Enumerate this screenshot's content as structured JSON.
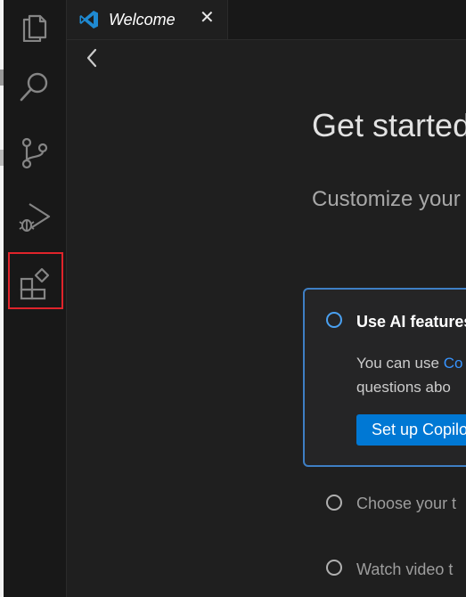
{
  "activity_bar": {
    "items": [
      {
        "name": "explorer",
        "icon": "files-icon"
      },
      {
        "name": "search",
        "icon": "search-icon"
      },
      {
        "name": "source-control",
        "icon": "source-control-icon"
      },
      {
        "name": "run-and-debug",
        "icon": "run-debug-icon"
      },
      {
        "name": "extensions",
        "icon": "extensions-icon",
        "highlighted": true
      }
    ]
  },
  "tab": {
    "label": "Welcome",
    "close": "✕",
    "icon": "vscode-icon"
  },
  "welcome": {
    "title": "Get started",
    "subtitle": "Customize your",
    "card": {
      "title": "Use AI features",
      "desc_prefix": "You can use ",
      "desc_link": "Co",
      "desc_line2": "questions abo",
      "button": "Set up Copilot"
    },
    "steps": [
      "Choose your t",
      "Watch video t"
    ]
  },
  "colors": {
    "accent": "#0078d4",
    "highlight": "#e0242b",
    "background": "#1f1f1f"
  }
}
